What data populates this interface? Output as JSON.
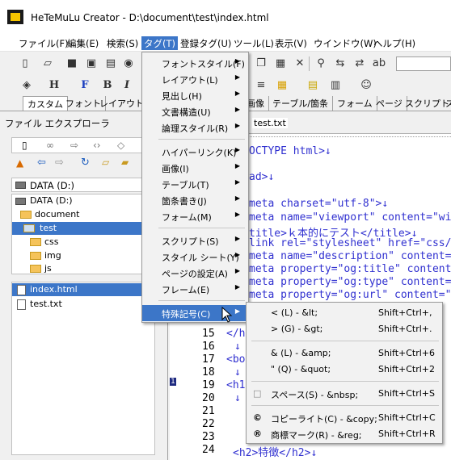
{
  "window": {
    "title": "HeTeMuLu Creator - D:\\document\\test\\index.html"
  },
  "menubar": [
    "ファイル(F)",
    "編集(E)",
    "検索(S)",
    "タグ(T)",
    "登録タグ(U)",
    "ツール(L)",
    "表示(V)",
    "ウインドウ(W)",
    "ヘルプ(H)"
  ],
  "tabstrip": [
    "カスタム",
    "フォント",
    "レイアウト",
    "画像",
    "テーブル/箇条",
    "フォーム",
    "ページ",
    "スクリプト",
    "ス"
  ],
  "explorer": {
    "title": "ファイル エクスプローラ",
    "drive1": "DATA (D:)",
    "drive2": "DATA (D:)",
    "tree": [
      "document",
      "test",
      "css",
      "img",
      "js"
    ],
    "files": [
      "index.html",
      "test.txt"
    ]
  },
  "editor": {
    "tab": "test.txt",
    "lines_top": [
      "OCTYPE html>↓",
      "ad>↓",
      "meta charset=\"utf-8\">↓",
      "meta name=\"viewport\" content=\"wi",
      "title>ｋ本的にテスト</title>↓",
      "link rel=\"stylesheet\" href=\"css/",
      "meta name=\"description\" content=",
      "meta property=\"og:title\" content",
      "meta property=\"og:type\" content=",
      "meta property=\"og:url\" content=\""
    ],
    "line_numbers": [
      "15",
      "16",
      "17",
      "18",
      "19",
      "20",
      "21",
      "22",
      "23",
      "24"
    ],
    "lines_bottom": [
      "</h",
      "↓",
      "<bo",
      "↓",
      "<h1",
      "↓",
      "",
      "",
      "",
      "<h2>特徴</h2>↓"
    ],
    "marker": "1"
  },
  "tag_menu": [
    {
      "label": "フォントスタイル(F)",
      "arrow": true
    },
    {
      "label": "レイアウト(L)",
      "arrow": true
    },
    {
      "label": "見出し(H)",
      "arrow": true
    },
    {
      "label": "文書構造(U)",
      "arrow": true
    },
    {
      "label": "論理スタイル(R)",
      "arrow": true
    },
    {
      "label": "ハイパーリンク(K)",
      "arrow": true
    },
    {
      "label": "画像(I)",
      "arrow": true
    },
    {
      "label": "テーブル(T)",
      "arrow": true
    },
    {
      "label": "箇条書き(J)",
      "arrow": true
    },
    {
      "label": "フォーム(M)",
      "arrow": true
    },
    {
      "label": "スクリプト(S)",
      "arrow": true
    },
    {
      "label": "スタイル シート(Y)",
      "arrow": true
    },
    {
      "label": "ページの設定(A)",
      "arrow": true
    },
    {
      "label": "フレーム(E)",
      "arrow": true
    },
    {
      "label": "特殊記号(C)",
      "arrow": true
    }
  ],
  "special_menu": [
    {
      "symbol": "<",
      "label": "< (L) - &lt;",
      "shortcut": "Shift+Ctrl+,"
    },
    {
      "symbol": ">",
      "label": "> (G) - &gt;",
      "shortcut": "Shift+Ctrl+."
    },
    {
      "symbol": "&",
      "label": "& (L) - &amp;",
      "shortcut": "Shift+Ctrl+6"
    },
    {
      "symbol": "\"",
      "label": "\" (Q) - &quot;",
      "shortcut": "Shift+Ctrl+2"
    },
    {
      "symbol": "□",
      "label": "スペース(S) - &nbsp;",
      "shortcut": "Shift+Ctrl+S"
    },
    {
      "symbol": "©",
      "label": "コピーライト(C) - &copy;",
      "shortcut": "Shift+Ctrl+C"
    },
    {
      "symbol": "®",
      "label": "商標マーク(R) - &reg;",
      "shortcut": "Shift+Ctrl+R"
    }
  ],
  "colors": {
    "accent": "#3c76c8",
    "code": "#3030d0",
    "folder": "#f5c35a"
  }
}
